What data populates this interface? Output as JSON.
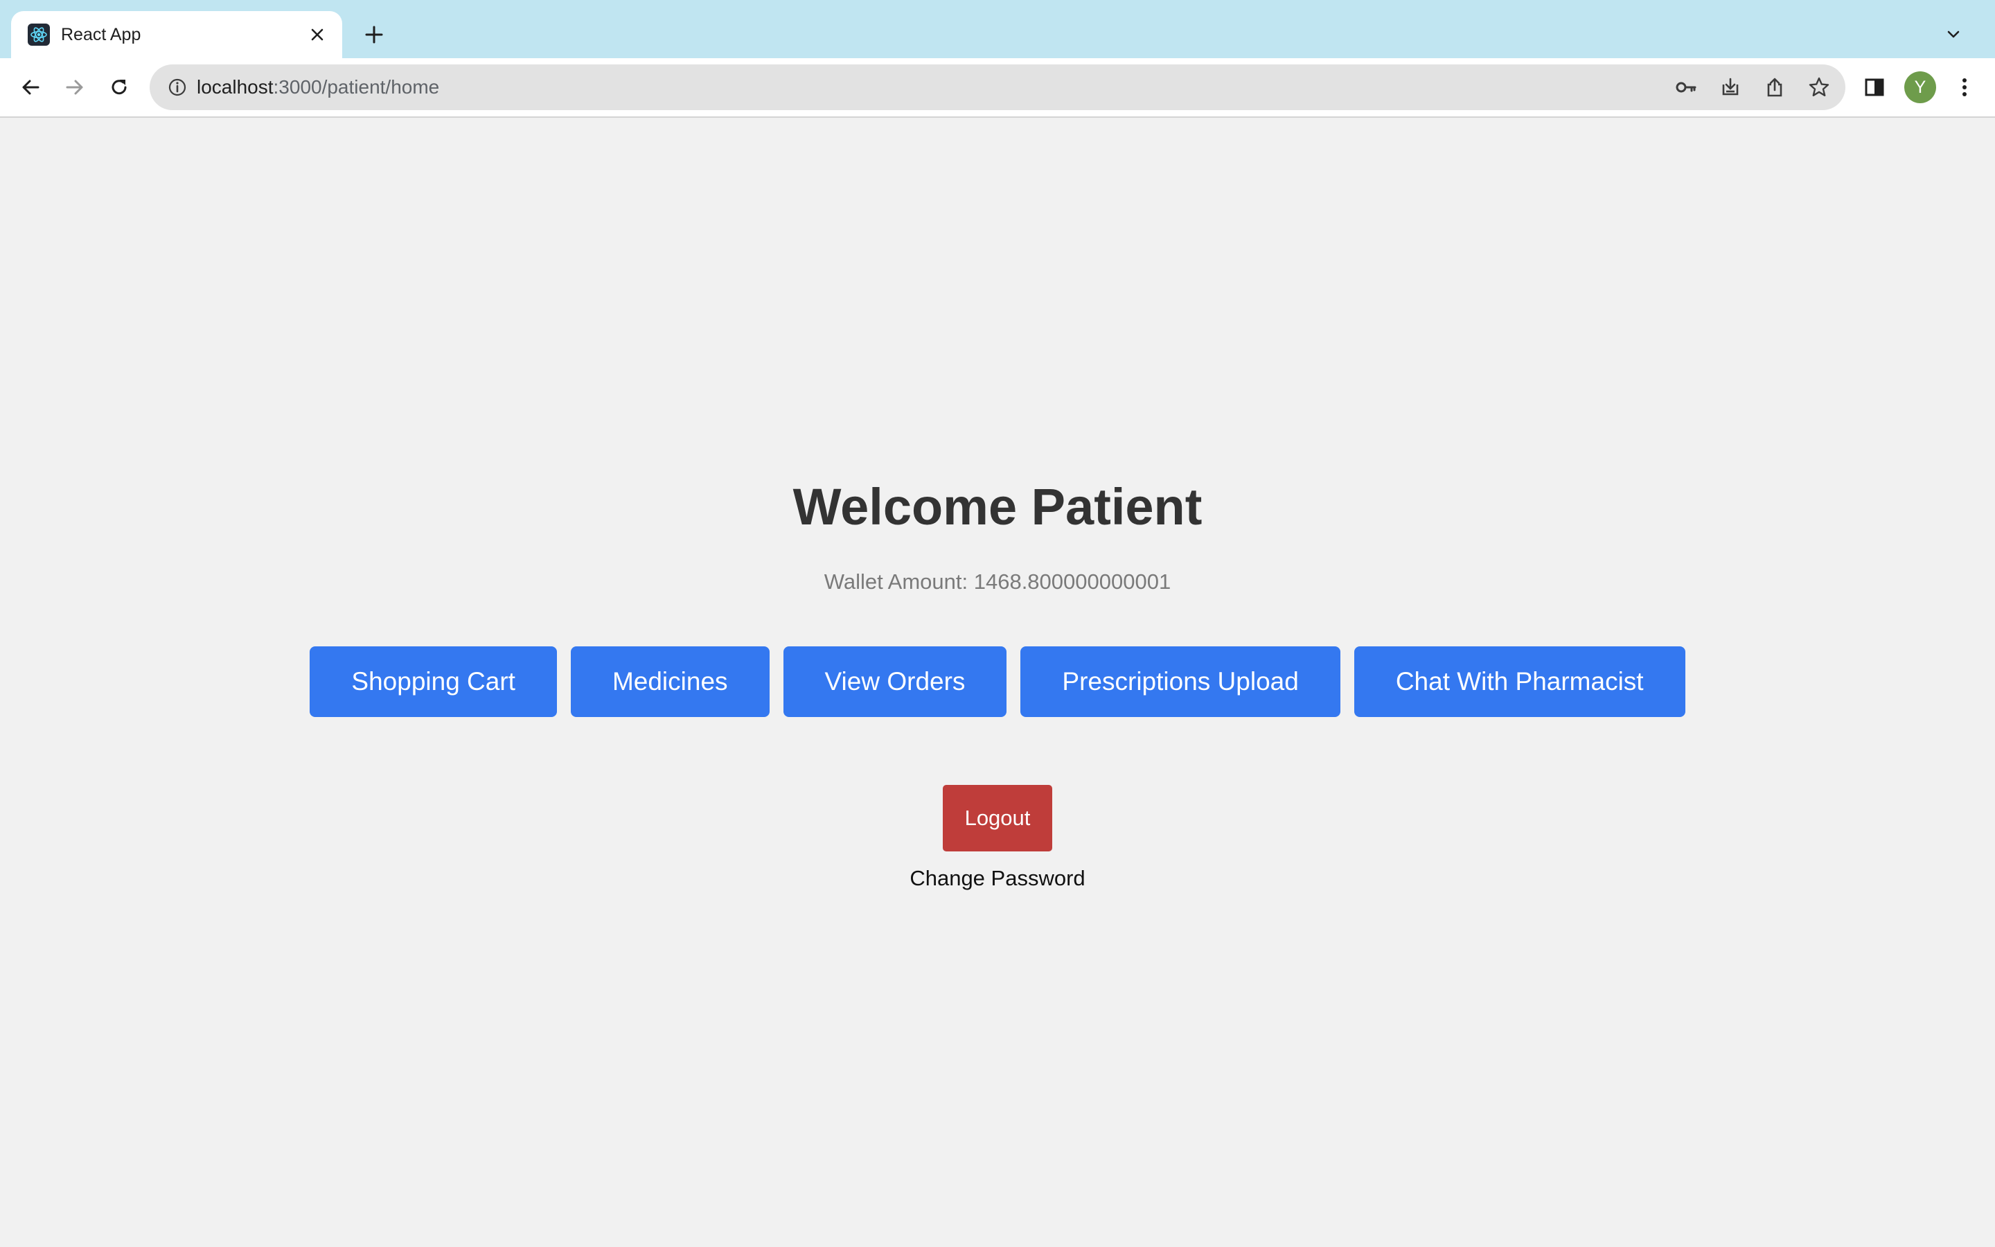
{
  "browser": {
    "tab": {
      "title": "React App"
    },
    "omnibox": {
      "host": "localhost",
      "path": ":3000/patient/home"
    },
    "profile_initial": "Y"
  },
  "page": {
    "heading": "Welcome Patient",
    "wallet_label": "Wallet Amount:",
    "wallet_amount": "1468.800000000001",
    "nav_buttons": [
      {
        "label": "Shopping Cart"
      },
      {
        "label": "Medicines"
      },
      {
        "label": "View Orders"
      },
      {
        "label": "Prescriptions Upload"
      },
      {
        "label": "Chat With Pharmacist"
      }
    ],
    "logout_label": "Logout",
    "change_password_label": "Change Password"
  },
  "colors": {
    "primary_button": "#3478f0",
    "logout_button": "#bf3d3a",
    "page_background": "#f1f1f1",
    "tabstrip": "#c0e5f1"
  }
}
